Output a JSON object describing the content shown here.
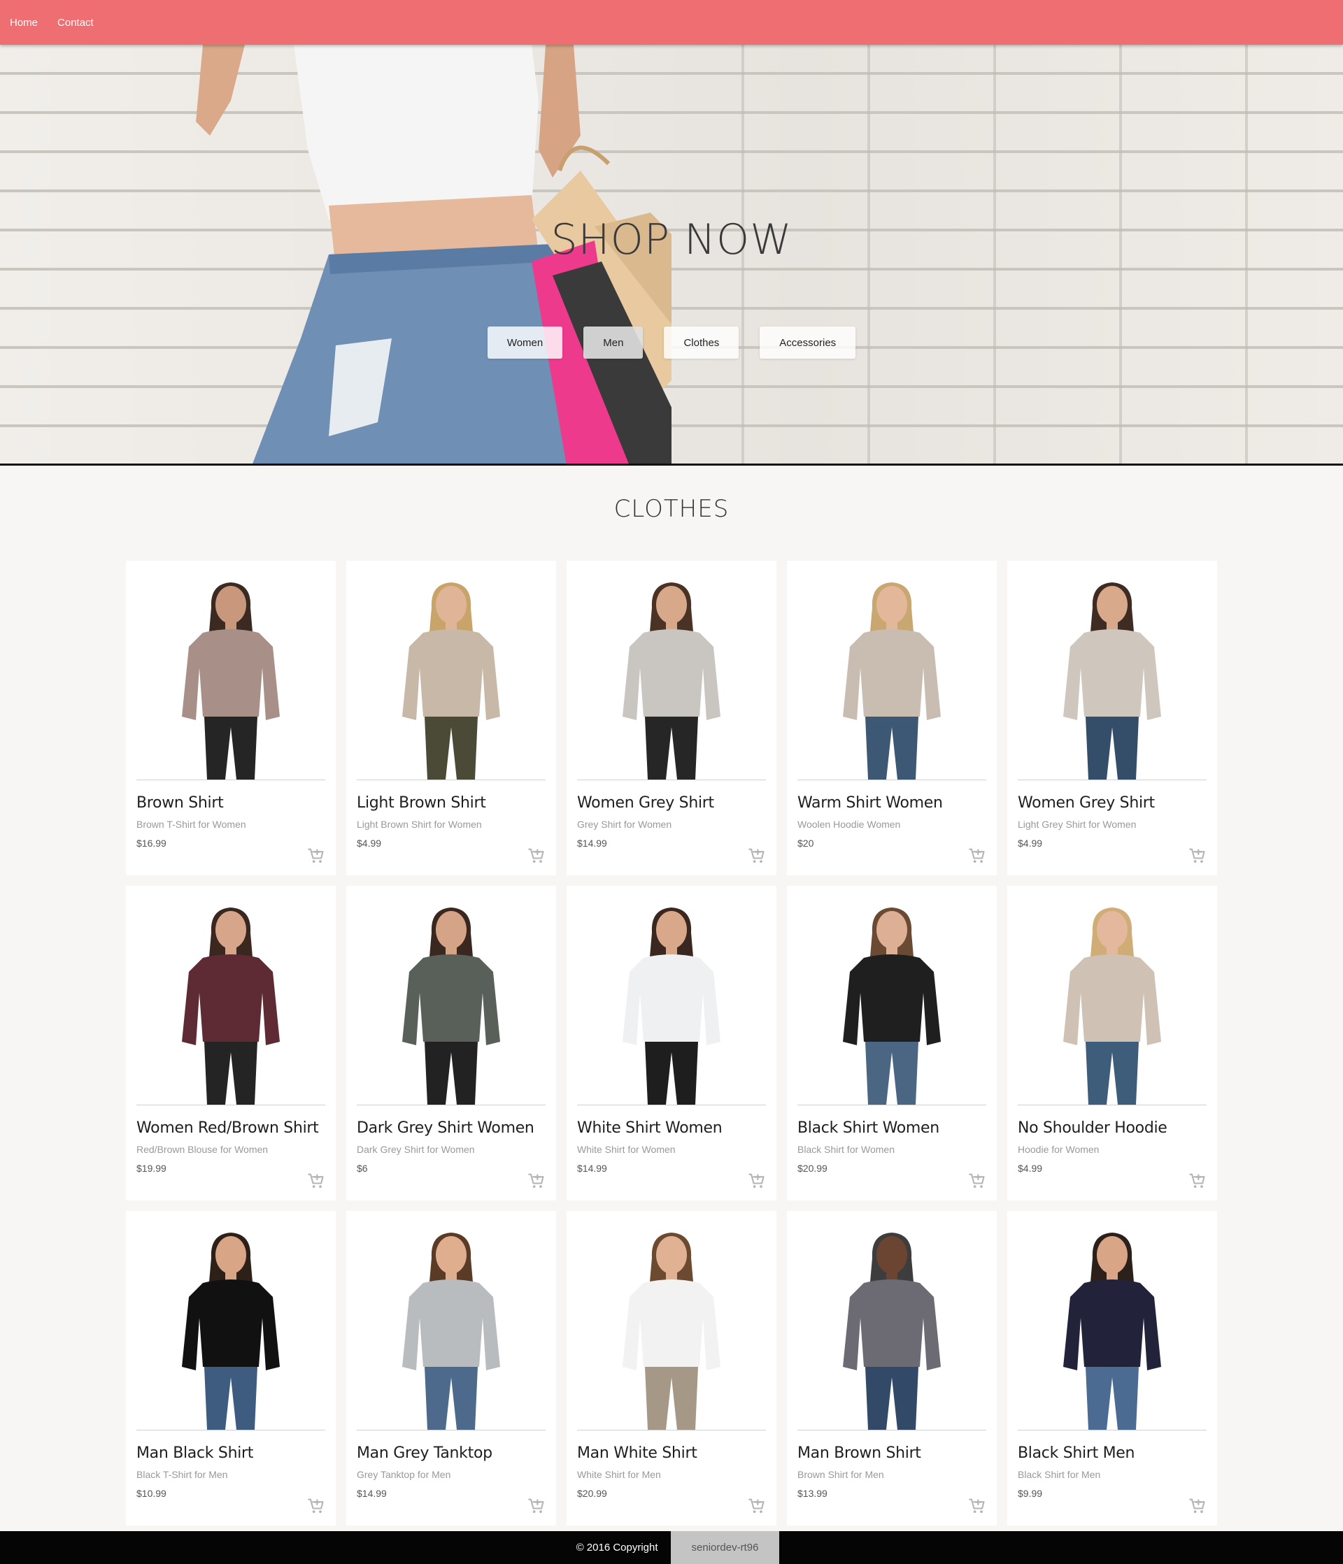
{
  "nav": {
    "links": [
      "Home",
      "Contact"
    ]
  },
  "hero": {
    "title": "SHOP NOW",
    "buttons": [
      "Women",
      "Men",
      "Clothes",
      "Accessories"
    ]
  },
  "section": {
    "title": "CLOTHES"
  },
  "products": [
    {
      "name": "Brown Shirt",
      "desc": "Brown T-Shirt for Women",
      "price": "$16.99",
      "color": "#a89089",
      "skin": "#c9987c",
      "hair": "#3b2a22",
      "pants": "#252525"
    },
    {
      "name": "Light Brown Shirt",
      "desc": "Light Brown Shirt for Women",
      "price": "$4.99",
      "color": "#c7b8a8",
      "skin": "#e0b496",
      "hair": "#c9a46a",
      "pants": "#4a4a36"
    },
    {
      "name": "Women Grey Shirt",
      "desc": "Grey Shirt for Women",
      "price": "$14.99",
      "color": "#c9c6c2",
      "skin": "#d7a88a",
      "hair": "#4a3224",
      "pants": "#262626"
    },
    {
      "name": "Warm Shirt Women",
      "desc": "Woolen Hoodie Women",
      "price": "$20",
      "color": "#c9bcb0",
      "skin": "#e2b79a",
      "hair": "#c9a771",
      "pants": "#3c5874"
    },
    {
      "name": "Women Grey Shirt",
      "desc": "Light Grey Shirt for Women",
      "price": "$4.99",
      "color": "#cfc6bd",
      "skin": "#d9a98c",
      "hair": "#3e2b21",
      "pants": "#344e6a"
    },
    {
      "name": "Women Red/Brown Shirt",
      "desc": "Red/Brown Blouse for Women",
      "price": "$19.99",
      "color": "#5e2a33",
      "skin": "#d6a58a",
      "hair": "#3a2820",
      "pants": "#242424"
    },
    {
      "name": "Dark Grey Shirt Women",
      "desc": "Dark Grey Shirt for Women",
      "price": "$6",
      "color": "#59605a",
      "skin": "#d5a486",
      "hair": "#3a2820",
      "pants": "#222222"
    },
    {
      "name": "White Shirt Women",
      "desc": "White Shirt for Women",
      "price": "$14.99",
      "color": "#eef0f2",
      "skin": "#d9a88b",
      "hair": "#3a2820",
      "pants": "#1e1e1e"
    },
    {
      "name": "Black Shirt Women",
      "desc": "Black Shirt for Women",
      "price": "$20.99",
      "color": "#1f1f1f",
      "skin": "#ddb095",
      "hair": "#6a4a33",
      "pants": "#4a6682"
    },
    {
      "name": "No Shoulder Hoodie",
      "desc": "Hoodie for Women",
      "price": "$4.99",
      "color": "#cfc2b4",
      "skin": "#e3b89c",
      "hair": "#d0ac76",
      "pants": "#3d5d7b"
    },
    {
      "name": "Man Black Shirt",
      "desc": "Black T-Shirt for Men",
      "price": "$10.99",
      "color": "#111111",
      "skin": "#d8a586",
      "hair": "#2c2019",
      "pants": "#3d5c80"
    },
    {
      "name": "Man Grey Tanktop",
      "desc": "Grey Tanktop for Men",
      "price": "$14.99",
      "color": "#b9bcbf",
      "skin": "#dfae8f",
      "hair": "#5a3b26",
      "pants": "#4d6a8c"
    },
    {
      "name": "Man White Shirt",
      "desc": "White Shirt for Men",
      "price": "$20.99",
      "color": "#f2f2f2",
      "skin": "#e0b193",
      "hair": "#6b4a30",
      "pants": "#a59886"
    },
    {
      "name": "Man Brown Shirt",
      "desc": "Brown Shirt for Men",
      "price": "$13.99",
      "color": "#6c6a72",
      "skin": "#6b4532",
      "hair": "#3d3d3d",
      "pants": "#324a68"
    },
    {
      "name": "Black Shirt Men",
      "desc": "Black Shirt for Men",
      "price": "$9.99",
      "color": "#22223a",
      "skin": "#d8a586",
      "hair": "#2b211a",
      "pants": "#4b6b92"
    }
  ],
  "footer": {
    "copyright": "© 2016 Copyright",
    "tag": "seniordev-rt96"
  }
}
